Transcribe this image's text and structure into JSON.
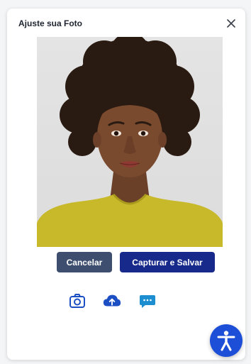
{
  "modal": {
    "title": "Ajuste sua Foto"
  },
  "icons": {
    "close": "close-icon",
    "camera": "camera-icon",
    "upload": "cloud-upload-icon",
    "chat": "chat-icon",
    "accessibility": "accessibility-icon"
  },
  "photo": {
    "subject": "portrait-photo"
  },
  "actions": {
    "cancel_label": "Cancelar",
    "capture_label": "Capturar e Salvar"
  },
  "colors": {
    "cancel_button": "#3d4e6f",
    "capture_button": "#17298a",
    "icon_blue": "#1d4fc4",
    "accessibility_fab": "#1d4ed8"
  }
}
